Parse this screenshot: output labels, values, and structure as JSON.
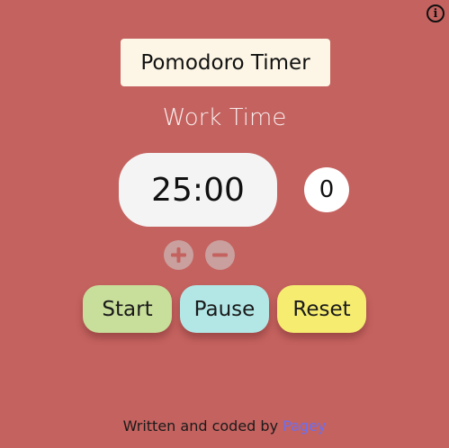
{
  "header": {
    "info_icon_glyph": "i",
    "title": "Pomodoro Timer"
  },
  "timer": {
    "mode_label": "Work Time",
    "time": "25:00",
    "session_count": "0"
  },
  "adjust": {
    "increase_icon": "plus-icon",
    "decrease_icon": "minus-icon"
  },
  "controls": {
    "start_label": "Start",
    "pause_label": "Pause",
    "reset_label": "Reset"
  },
  "footer": {
    "text": "Written and coded by",
    "author_link": "Pagey"
  },
  "colors": {
    "background": "#c4625f",
    "title_bg": "#fdf6e6",
    "start": "#c8de9b",
    "pause": "#b2e7e6",
    "reset": "#f5ec70",
    "link": "#6b6ff0"
  }
}
